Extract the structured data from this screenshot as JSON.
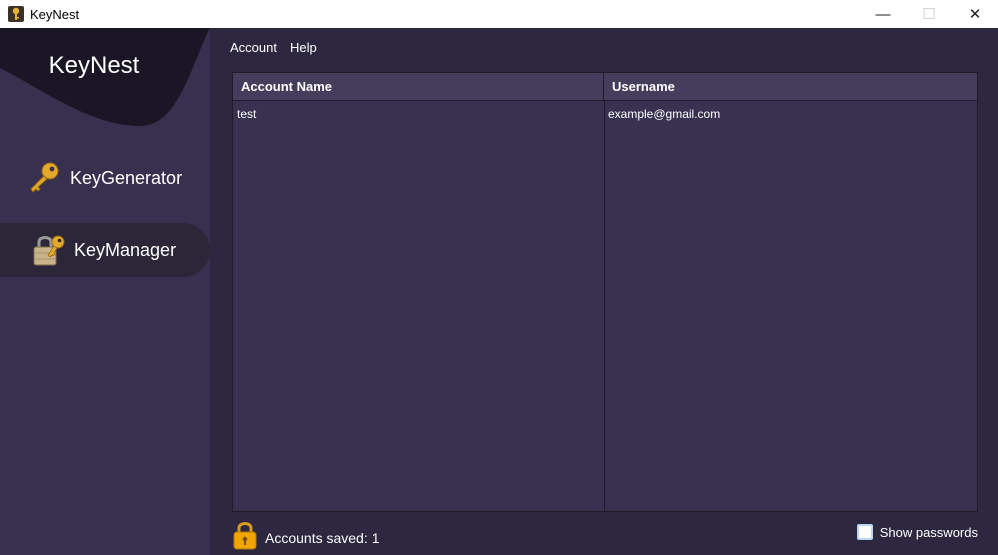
{
  "window": {
    "title": "KeyNest",
    "minimize": "—",
    "maximize": "☐",
    "close": "✕"
  },
  "sidebar": {
    "brand": "KeyNest",
    "items": [
      {
        "label": "KeyGenerator",
        "icon": "key-icon",
        "active": false
      },
      {
        "label": "KeyManager",
        "icon": "padlock-key-icon",
        "active": true
      }
    ]
  },
  "menubar": {
    "items": [
      "Account",
      "Help"
    ]
  },
  "table": {
    "columns": [
      "Account Name",
      "Username"
    ],
    "rows": [
      [
        "test",
        "example@gmail.com"
      ]
    ]
  },
  "footer": {
    "label": "Accounts saved:",
    "count": "1",
    "show_passwords_label": "Show passwords",
    "show_passwords_checked": false
  },
  "colors": {
    "sidebar_bg": "#38304e",
    "brand_bg": "#1a1625",
    "main_bg": "#2d283f",
    "table_bg": "#383150",
    "accent_gold": "#f0a500"
  }
}
